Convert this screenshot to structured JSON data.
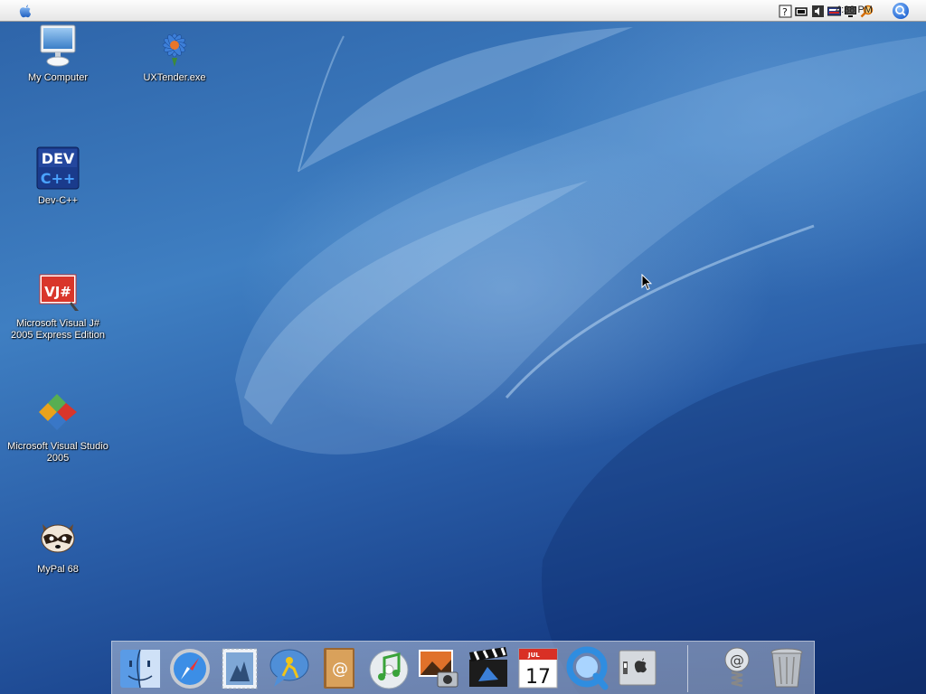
{
  "menubar": {
    "clock": "4:38 PM",
    "tray_icons": [
      "help-icon",
      "battery-icon",
      "volume-icon",
      "keyboard-icon",
      "display-icon",
      "magnifier-icon"
    ]
  },
  "desktop_icons": [
    {
      "name": "my-computer",
      "label": "My Computer"
    },
    {
      "name": "uxtender",
      "label": "UXTender.exe"
    },
    {
      "name": "dev-cpp",
      "label": "Dev-C++"
    },
    {
      "name": "visual-jsharp",
      "label": "Microsoft Visual J#\n2005 Express Edition"
    },
    {
      "name": "visual-studio",
      "label": "Microsoft Visual Studio\n2005"
    },
    {
      "name": "mypal",
      "label": "MyPal 68"
    }
  ],
  "dock": {
    "apps": [
      "finder",
      "safari",
      "mail",
      "ichat",
      "address-book",
      "itunes",
      "iphoto",
      "imovie",
      "ical",
      "quicktime",
      "system-preferences"
    ],
    "right": [
      "mail-at",
      "trash"
    ],
    "ical_month": "JUL",
    "ical_day": "17",
    "devcpp_top": "DEV",
    "devcpp_bottom": "C++",
    "vj_text": "VJ#"
  },
  "colors": {
    "wallpaper": "#2d63a8",
    "menubar": "#f2f2f2"
  }
}
